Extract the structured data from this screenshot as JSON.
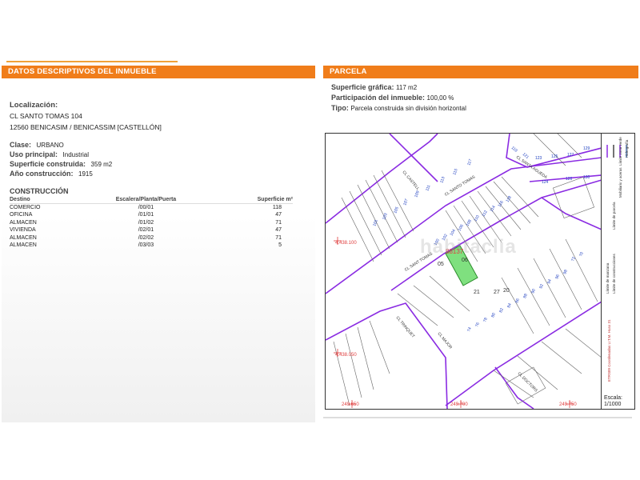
{
  "left": {
    "header": "DATOS DESCRIPTIVOS DEL INMUEBLE",
    "localizacion_label": "Localización:",
    "address_line1": "CL SANTO TOMAS 104",
    "address_line2": "12560 BENICASIM / BENICASSIM [CASTELLÓN]",
    "clase_label": "Clase:",
    "clase_value": "URBANO",
    "uso_label": "Uso principal:",
    "uso_value": "Industrial",
    "superficie_label": "Superficie construida:",
    "superficie_value": "359 m2",
    "anio_label": "Año construcción:",
    "anio_value": "1915",
    "construccion_title": "CONSTRUCCIÓN",
    "table_headers": [
      "Destino",
      "Escalera/Planta/Puerta",
      "Superficie m²"
    ],
    "table_rows": [
      [
        "COMERCIO",
        "/00/01",
        "118"
      ],
      [
        "OFICINA",
        "/01/01",
        "47"
      ],
      [
        "ALMACEN",
        "/01/02",
        "71"
      ],
      [
        "VIVIENDA",
        "/02/01",
        "47"
      ],
      [
        "ALMACEN",
        "/02/02",
        "71"
      ],
      [
        "ALMACEN",
        "/03/03",
        "5"
      ]
    ]
  },
  "right": {
    "header": "PARCELA",
    "sup_grafica_label": "Superficie gráfica:",
    "sup_grafica_value": "117 m2",
    "participacion_label": "Participación del inmueble:",
    "participacion_value": "100,00 %",
    "tipo_label": "Tipo:",
    "tipo_value": "Parcela construida sin división horizontal",
    "escala_label": "Escala:",
    "escala_value": "1/1000"
  },
  "map": {
    "streets": [
      "CL CASTELL",
      "CL SANTO TOMAS",
      "CL SANT TOMAS",
      "CL SANTA AGUEDA",
      "CL MAJOR",
      "CL TRINQUET",
      "CL DOCTORS"
    ],
    "coords": [
      "4.438.100",
      "4.438.050",
      "249.650",
      "249.700",
      "249.750"
    ],
    "parcel_label": "88137",
    "parcel_sub": "06",
    "numbers": [
      "117",
      "115",
      "113",
      "111",
      "109",
      "107",
      "105",
      "103",
      "101",
      "118",
      "116",
      "114",
      "112",
      "110",
      "108",
      "106",
      "104",
      "102",
      "100",
      "05",
      "21",
      "27",
      "20",
      "123",
      "125",
      "127",
      "124",
      "126",
      "130",
      "129",
      "121",
      "119",
      "98",
      "96",
      "94",
      "92",
      "90",
      "88",
      "86",
      "84",
      "82",
      "80",
      "78",
      "76",
      "74",
      "72",
      "70"
    ],
    "legend": [
      "Límite de manzana",
      "Límite de parcela",
      "Límite de construcciones",
      "Mobiliario y aceras",
      "Límite zona verde",
      "Hidrografía"
    ],
    "legend_note": "ETRS89 Coordenadas U.T.M. Huso 31"
  },
  "watermark": "habitaclia"
}
